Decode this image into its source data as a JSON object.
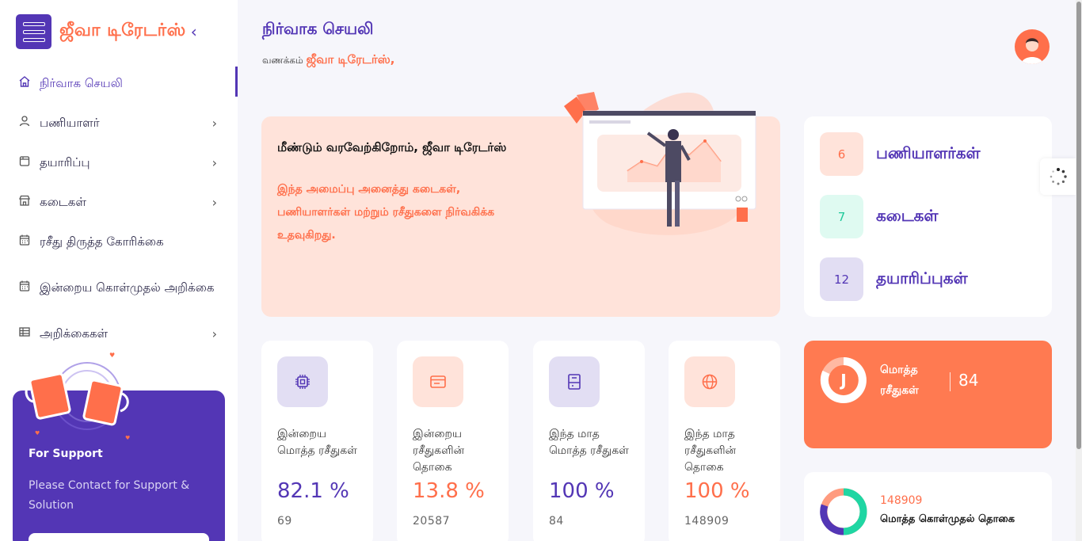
{
  "brand": {
    "name": "ஜீவா டிரேடர்ஸ்",
    "collapse_icon": "chevron-left-icon"
  },
  "header": {
    "title": "நிர்வாக செயலி",
    "greeting_prefix": "வணக்கம்",
    "greeting_name": "ஜீவா டிரேடர்ஸ்,"
  },
  "sidebar": {
    "items": [
      {
        "label": "நிர்வாக செயலி",
        "icon": "home-icon",
        "active": true
      },
      {
        "label": "பணியாளர்",
        "icon": "user-icon",
        "chevron": true
      },
      {
        "label": "தயாரிப்பு",
        "icon": "box-icon",
        "chevron": true
      },
      {
        "label": "கடைகள்",
        "icon": "store-icon",
        "chevron": true
      },
      {
        "label": "ரசீது திருத்த கோரிக்கை",
        "icon": "calendar-icon"
      },
      {
        "label": "இன்றைய கொள்முதல் அறிக்கை",
        "icon": "calendar-icon"
      },
      {
        "label": "அறிக்கைகள்",
        "icon": "table-icon",
        "chevron": true
      }
    ],
    "support": {
      "title": "For Support",
      "text": "Please Contact for Support & Solution"
    }
  },
  "welcome": {
    "title": "மீண்டும் வரவேற்கிறோம், ஜீவா டிரேடர்ஸ்",
    "description": "இந்த அமைப்பு அனைத்து கடைகள், பணியாளர்கள் மற்றும் ரசீதுகளை நிர்வகிக்க உதவுகிறது."
  },
  "counters": [
    {
      "value": "6",
      "label": "பணியாளர்கள்",
      "bg": "#ffe3da",
      "fg": "#ff6f4b"
    },
    {
      "value": "7",
      "label": "கடைகள்",
      "bg": "#dffaf1",
      "fg": "#1fc99a"
    },
    {
      "value": "12",
      "label": "தயாரிப்புகள்",
      "bg": "#e2def3",
      "fg": "#5336b5"
    }
  ],
  "stats": [
    {
      "label": "இன்றைய மொத்த ரசீதுகள்",
      "value": "82.1 %",
      "sub": "69",
      "icon": "chip-icon",
      "bg": "#e2def3",
      "color": "#5336b5"
    },
    {
      "label": "இன்றைய ரசீதுகளின் தொகை",
      "value": "13.8 %",
      "sub": "20587",
      "icon": "window-icon",
      "bg": "#ffe3da",
      "color": "#ff6f4b"
    },
    {
      "label": "இந்த மாத மொத்த ரசீதுகள்",
      "value": "100 %",
      "sub": "84",
      "icon": "drive-icon",
      "bg": "#e2def3",
      "color": "#5336b5"
    },
    {
      "label": "இந்த மாத ரசீதுகளின் தொகை",
      "value": "100 %",
      "sub": "148909",
      "icon": "globe-icon",
      "bg": "#ffe3da",
      "color": "#ff6f4b"
    }
  ],
  "total_receipts": {
    "letter": "J",
    "label": "மொத்த ரசீதுகள்",
    "value": "84"
  },
  "total_purchase": {
    "value": "148909",
    "label": "மொத்த கொள்முதல் தொகை"
  },
  "colors": {
    "primary": "#5336b5",
    "accent": "#ff6f4b",
    "teal": "#1fc99a"
  }
}
